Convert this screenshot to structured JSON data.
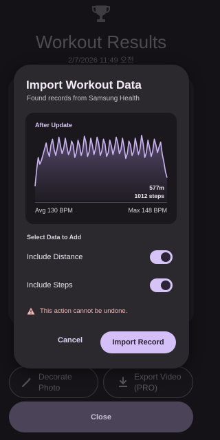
{
  "background": {
    "title": "Workout Results",
    "date": "2/7/2026 11:49 오전",
    "decorate_label_line1": "Decorate",
    "decorate_label_line2": "Photo",
    "export_label_line1": "Export Video",
    "export_label_line2": "(PRO)",
    "close_label": "Close"
  },
  "dialog": {
    "title": "Import Workout Data",
    "subtitle": "Found records from Samsung Health",
    "chart_title": "After Update",
    "distance_value": "577m",
    "steps_value": "1012 steps",
    "avg_bpm": "Avg 130 BPM",
    "max_bpm": "Max 148 BPM",
    "section_label": "Select Data to Add",
    "toggles": [
      {
        "label": "Include Distance",
        "on": true
      },
      {
        "label": "Include Steps",
        "on": true
      }
    ],
    "warning": "This action cannot be undone.",
    "cancel_label": "Cancel",
    "import_label": "Import Record"
  },
  "colors": {
    "accent": "#d4c0f6",
    "chart_line": "#cbb6f2",
    "warning": "#f2b7b5",
    "dialog_bg": "#2b292e"
  },
  "chart_data": {
    "type": "area",
    "title": "After Update",
    "series": [
      {
        "values": [
          95,
          112,
          125,
          118,
          122,
          128,
          134,
          140,
          131,
          126,
          138,
          144,
          133,
          127,
          135,
          146,
          137,
          129,
          134,
          145,
          136,
          128,
          132,
          142,
          138,
          125,
          130,
          143,
          137,
          127,
          133,
          147,
          141,
          126,
          131,
          145,
          138,
          128,
          134,
          146,
          140,
          127,
          132,
          144,
          139,
          126,
          130,
          143,
          137,
          128,
          135,
          146,
          140,
          129,
          133,
          145,
          136,
          124,
          129,
          142,
          138,
          127,
          131,
          145,
          137,
          128,
          134,
          148,
          139,
          125,
          130,
          143,
          135,
          126,
          132,
          144,
          138,
          130,
          136,
          141,
          128,
          120,
          110,
          104
        ]
      }
    ],
    "ylim": [
      80,
      150
    ]
  }
}
